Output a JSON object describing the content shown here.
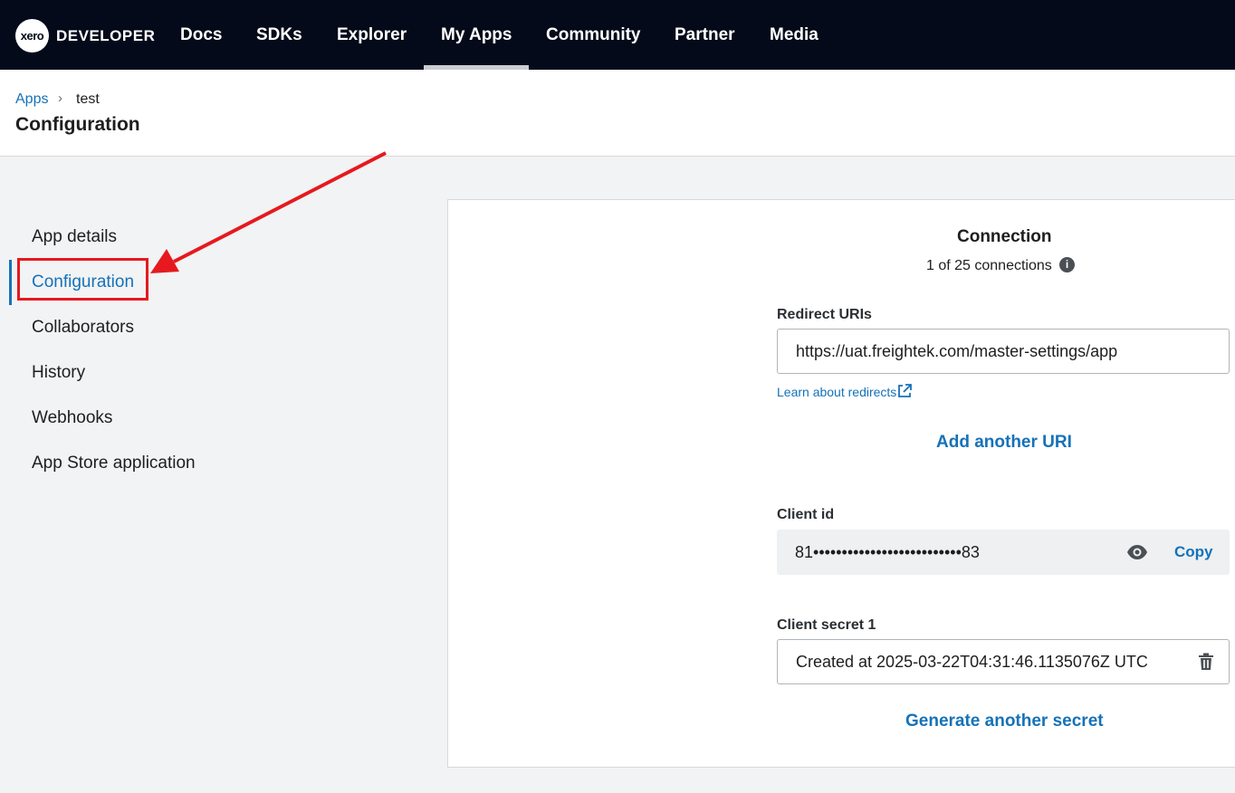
{
  "nav": {
    "logo_mark": "xero",
    "logo_text": "DEVELOPER",
    "items": [
      "Docs",
      "SDKs",
      "Explorer",
      "My Apps",
      "Community",
      "Partner",
      "Media"
    ],
    "active": "My Apps"
  },
  "breadcrumb": {
    "parent": "Apps",
    "separator": "›",
    "current": "test"
  },
  "page_title": "Configuration",
  "sidebar": {
    "items": [
      "App details",
      "Configuration",
      "Collaborators",
      "History",
      "Webhooks",
      "App Store application"
    ],
    "active": "Configuration"
  },
  "connection": {
    "title": "Connection",
    "count_text": "1 of 25 connections",
    "info_icon": "info-icon"
  },
  "redirect": {
    "label": "Redirect URIs",
    "value": "https://uat.freightek.com/master-settings/app",
    "learn_link": "Learn about redirects",
    "add_label": "Add another URI"
  },
  "client_id": {
    "label": "Client id",
    "value": "81••••••••••••••••••••••••••83",
    "copy_label": "Copy",
    "reveal_icon": "eye-icon"
  },
  "client_secret": {
    "label": "Client secret 1",
    "value": "Created at 2025-03-22T04:31:46.1135076Z UTC",
    "delete_icon": "trash-icon",
    "generate_label": "Generate another secret"
  },
  "colors": {
    "nav_bg": "#040a1a",
    "link": "#1572b8",
    "annotation": "#e6191e"
  }
}
